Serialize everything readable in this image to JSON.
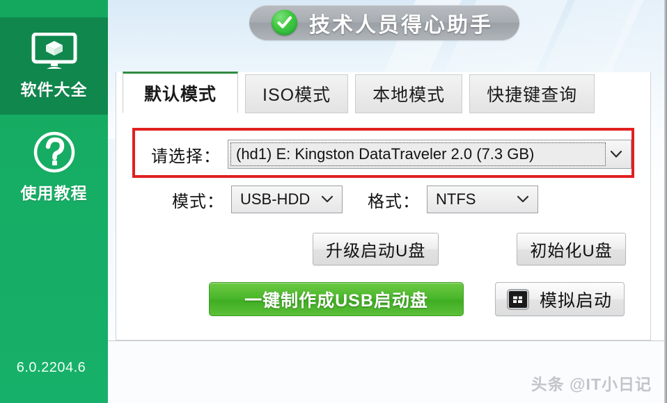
{
  "app": {
    "header_title": "技术人员得心助手",
    "header_icon": "green-check-circle-icon",
    "version": "6.0.2204.6",
    "watermark": "头条 @IT小日记",
    "accent_green": "#16ab62",
    "sidebar_active_green": "#10874d",
    "annotation_red": "#e02020",
    "primary_button_green": "#4cb82c"
  },
  "sidebar": {
    "items": [
      {
        "label": "软件大全",
        "icon": "monitor-package-icon",
        "active": true
      },
      {
        "label": "使用教程",
        "icon": "question-circle-icon",
        "active": false
      }
    ]
  },
  "tabs": [
    {
      "label": "默认模式",
      "active": true
    },
    {
      "label": "ISO模式",
      "active": false
    },
    {
      "label": "本地模式",
      "active": false
    },
    {
      "label": "快捷键查询",
      "active": false
    }
  ],
  "form": {
    "select_label": "请选择：",
    "device_value": "(hd1) E: Kingston DataTraveler 2.0 (7.3 GB)",
    "mode_label": "模式：",
    "mode_value": "USB-HDD",
    "format_label": "格式：",
    "format_value": "NTFS",
    "dropdown_icon": "chevron-down-icon"
  },
  "buttons": {
    "upgrade": "升级启动U盘",
    "initialize": "初始化U盘",
    "make_usb": "一键制作成USB启动盘",
    "simulate": "模拟启动",
    "simulate_icon": "virtual-machine-icon"
  }
}
